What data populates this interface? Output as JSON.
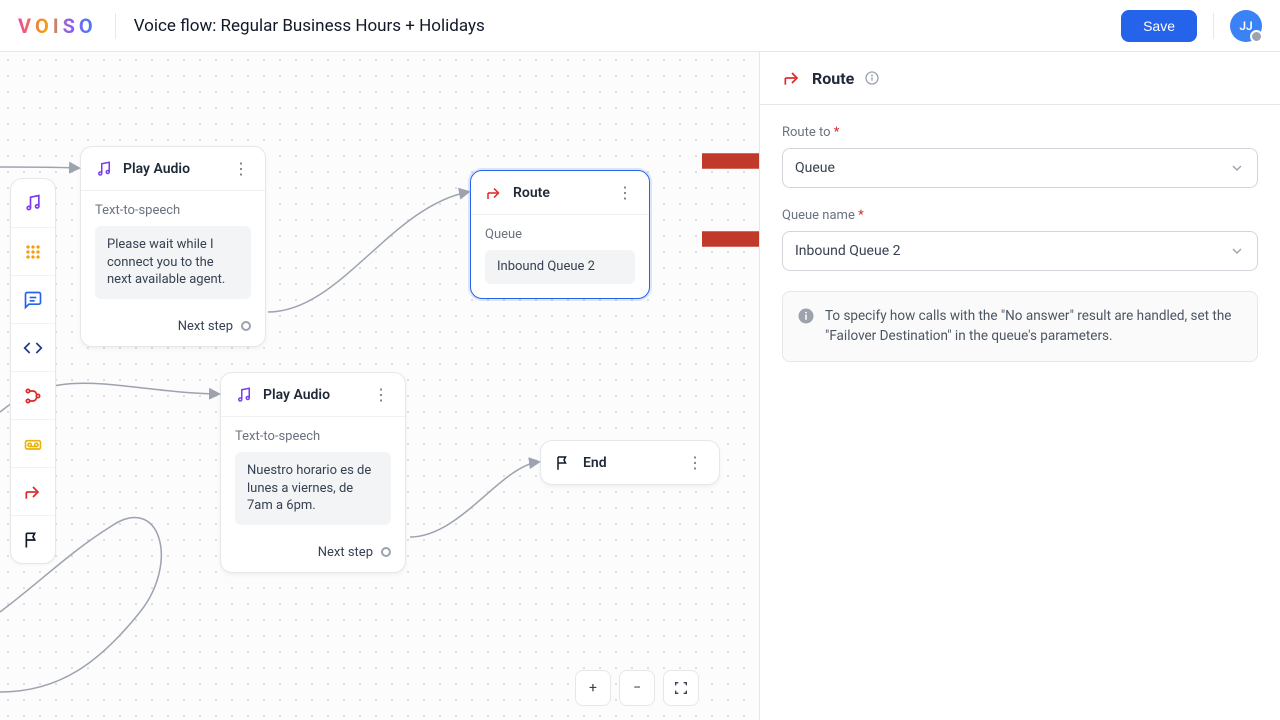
{
  "header": {
    "logo": "VOISO",
    "title": "Voice flow: Regular Business Hours + Holidays",
    "save": "Save",
    "avatar": "JJ"
  },
  "palette": {
    "items": [
      "audio",
      "dialpad",
      "message",
      "code",
      "branch",
      "voicemail",
      "route",
      "end"
    ]
  },
  "nodes": {
    "playAudio1": {
      "title": "Play Audio",
      "subtitle": "Text-to-speech",
      "text": "Please wait while I connect you to the next available agent.",
      "next": "Next step"
    },
    "route": {
      "title": "Route",
      "subtitle": "Queue",
      "chip": "Inbound Queue 2"
    },
    "playAudio2": {
      "title": "Play Audio",
      "subtitle": "Text-to-speech",
      "text": "Nuestro horario es de lunes a viernes, de 7am a 6pm.",
      "next": "Next step"
    },
    "end": {
      "title": "End"
    }
  },
  "panel": {
    "title": "Route",
    "routeTo": {
      "label": "Route to",
      "value": "Queue"
    },
    "queueName": {
      "label": "Queue name",
      "value": "Inbound Queue 2"
    },
    "note": "To specify how calls with the \"No answer\" result are handled, set the \"Failover Destination\" in the queue's parameters."
  },
  "zoom": {
    "in": "+",
    "out": "−"
  }
}
